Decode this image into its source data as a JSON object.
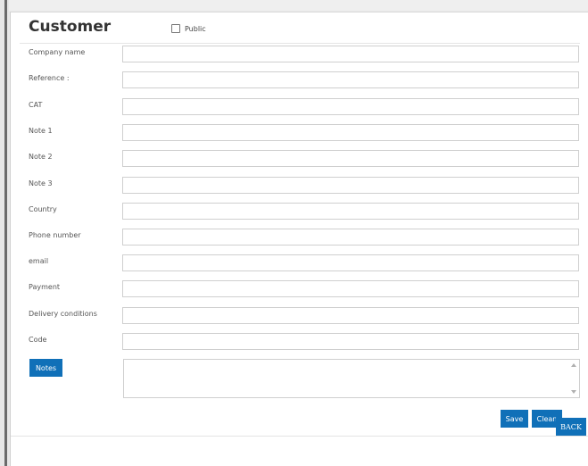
{
  "dialog": {
    "title": "Customer",
    "public_label": "Public",
    "public_checked": false
  },
  "form": {
    "fields": [
      {
        "label": "Company name",
        "value": ""
      },
      {
        "label": "Reference :",
        "value": ""
      },
      {
        "label": "CAT",
        "value": ""
      },
      {
        "label": "Note 1",
        "value": ""
      },
      {
        "label": "Note 2",
        "value": ""
      },
      {
        "label": "Note 3",
        "value": ""
      },
      {
        "label": "Country",
        "value": ""
      },
      {
        "label": "Phone number",
        "value": ""
      },
      {
        "label": "email",
        "value": ""
      },
      {
        "label": "Payment",
        "value": ""
      },
      {
        "label": "Delivery conditions",
        "value": ""
      },
      {
        "label": "Code",
        "value": ""
      }
    ],
    "notes_label": "Notes",
    "notes_value": ""
  },
  "actions": {
    "save_label": "Save",
    "clean_label": "Clean",
    "back_label": "BACK"
  },
  "colors": {
    "accent": "#1070b8"
  }
}
